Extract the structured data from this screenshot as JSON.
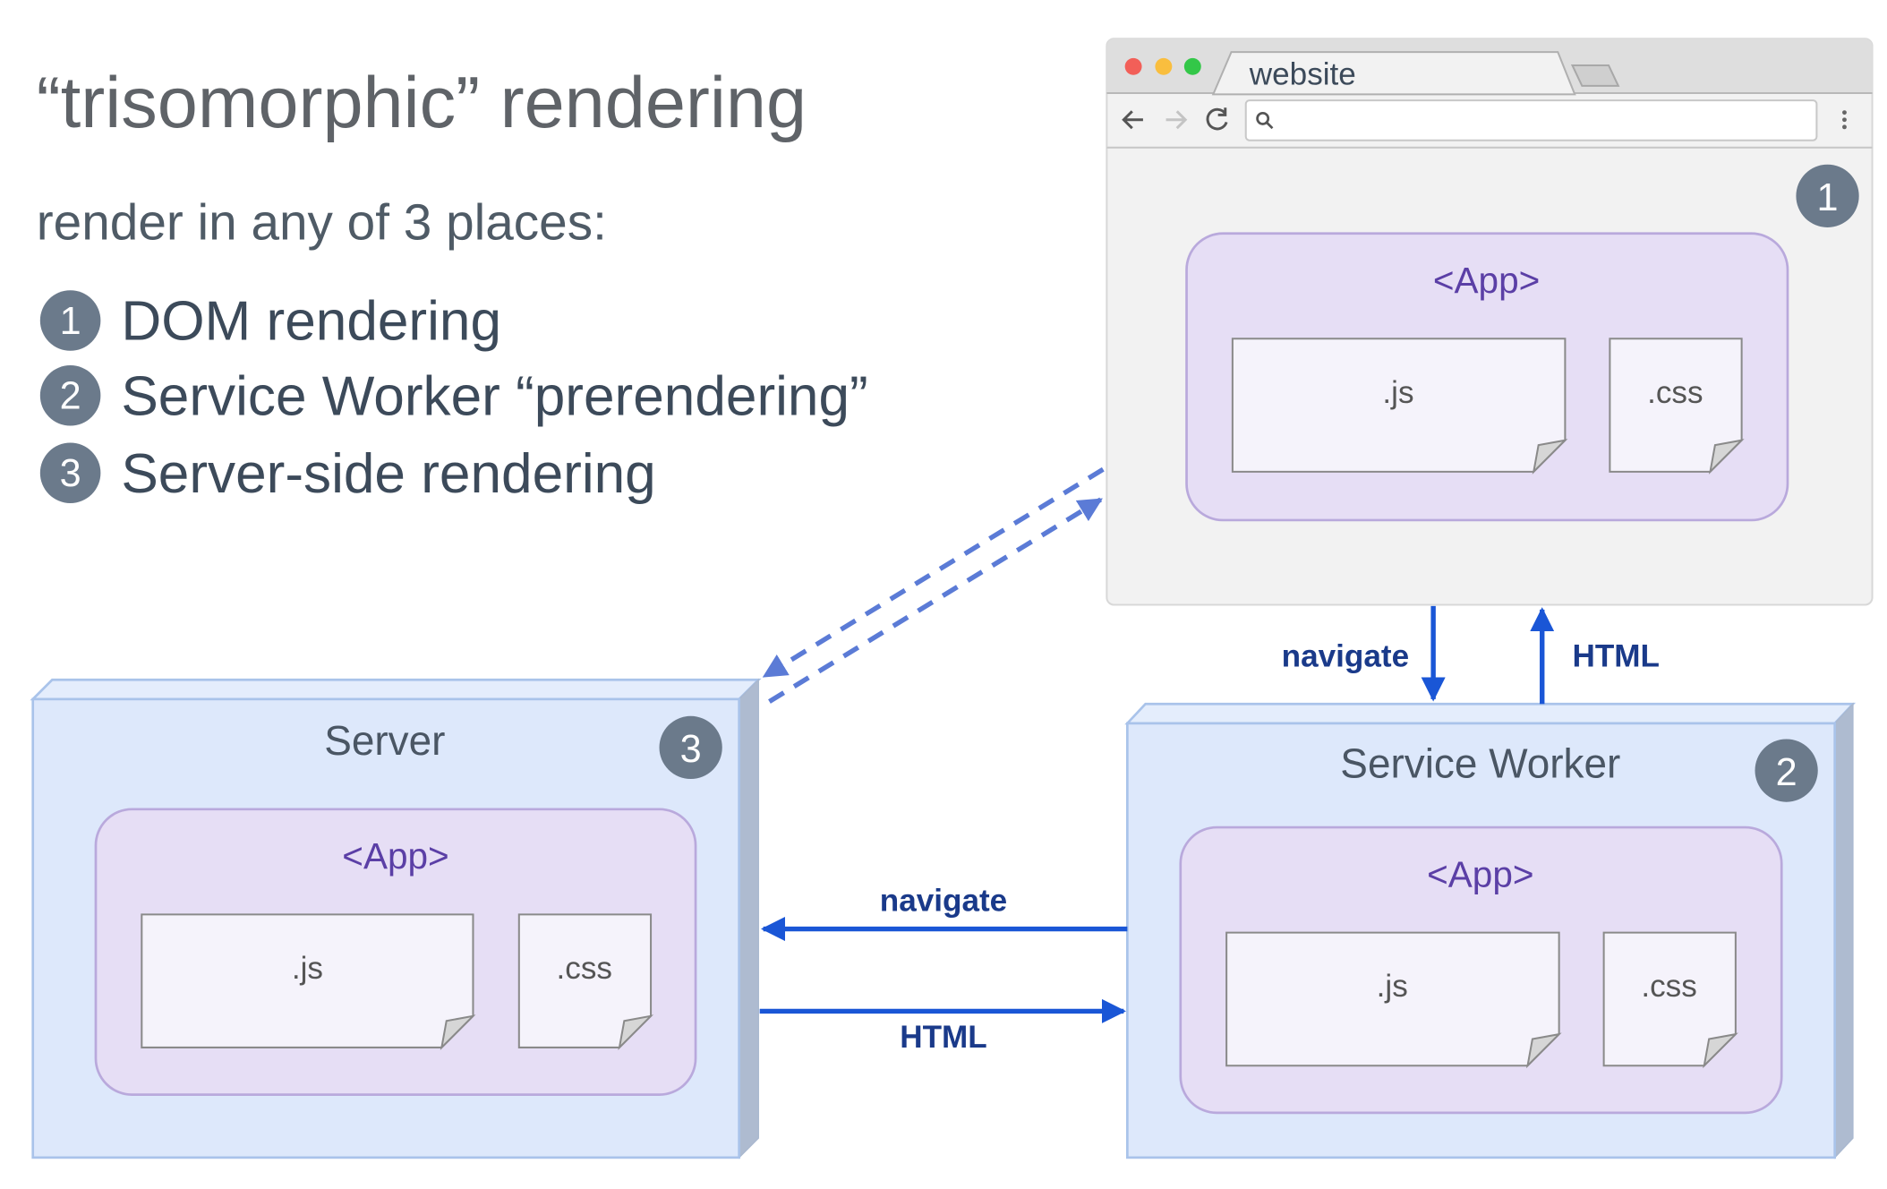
{
  "title": "“trisomorphic” rendering",
  "subtitle": "render in any of 3 places:",
  "places": [
    {
      "number": "1",
      "label": "DOM rendering"
    },
    {
      "number": "2",
      "label": "Service Worker “prerendering”"
    },
    {
      "number": "3",
      "label": "Server-side rendering"
    }
  ],
  "browser": {
    "tab_title": "website",
    "address_value": "",
    "badge": "1",
    "icons": [
      "back-arrow-icon",
      "forward-arrow-icon",
      "reload-icon",
      "search-icon",
      "more-vert-icon"
    ],
    "traffic_light_colors": [
      "#f25f58",
      "#f9be3e",
      "#33c748"
    ],
    "app": {
      "label": "<App>",
      "files": [
        ".js",
        ".css"
      ]
    }
  },
  "server": {
    "title": "Server",
    "badge": "3",
    "app": {
      "label": "<App>",
      "files": [
        ".js",
        ".css"
      ]
    }
  },
  "service_worker": {
    "title": "Service Worker",
    "badge": "2",
    "app": {
      "label": "<App>",
      "files": [
        ".js",
        ".css"
      ]
    }
  },
  "arrows": {
    "browser_to_sw": "navigate",
    "sw_to_browser": "HTML",
    "sw_to_server": "navigate",
    "server_to_sw": "HTML"
  },
  "colors": {
    "arrow": "#1a56d6",
    "dashed_arrow": "#5b7bd6",
    "app_box": "#e6def5",
    "node_box": "#dde8fb",
    "badge": "#6b7a8b"
  }
}
